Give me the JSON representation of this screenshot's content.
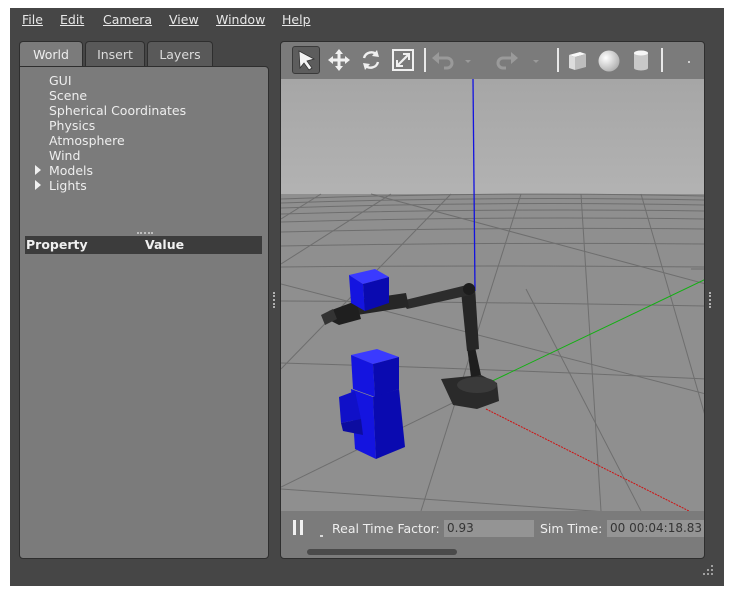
{
  "menu": [
    "File",
    "Edit",
    "Camera",
    "View",
    "Window",
    "Help"
  ],
  "left_panel": {
    "tabs": [
      "World",
      "Insert",
      "Layers"
    ],
    "active_tab": "World",
    "tree": [
      {
        "label": "GUI",
        "expandable": false
      },
      {
        "label": "Scene",
        "expandable": false
      },
      {
        "label": "Spherical Coordinates",
        "expandable": false
      },
      {
        "label": "Physics",
        "expandable": false
      },
      {
        "label": "Atmosphere",
        "expandable": false
      },
      {
        "label": "Wind",
        "expandable": false
      },
      {
        "label": "Models",
        "expandable": true
      },
      {
        "label": "Lights",
        "expandable": true
      }
    ],
    "property_header": {
      "property": "Property",
      "value": "Value"
    }
  },
  "toolbar": {
    "tools": [
      "select-mode",
      "translate-mode",
      "rotate-mode",
      "scale-mode",
      "undo",
      "undo-menu",
      "redo",
      "redo-menu",
      "box-shape",
      "sphere-shape",
      "cylinder-shape"
    ],
    "selected": "select-mode"
  },
  "status": {
    "real_time_factor_label": "Real Time Factor:",
    "real_time_factor": "0.93",
    "sim_time_label": "Sim Time:",
    "sim_time": "00 00:04:18.83"
  },
  "colors": {
    "background": "#464646",
    "panel": "#7b7b7b",
    "sky": "#a9a9a9",
    "ground": "#8f8f8f",
    "blue_objects": "#1010d8",
    "robot": "#262626",
    "x_axis": "#d01010",
    "y_axis": "#10b010",
    "z_axis": "#1010e0"
  }
}
